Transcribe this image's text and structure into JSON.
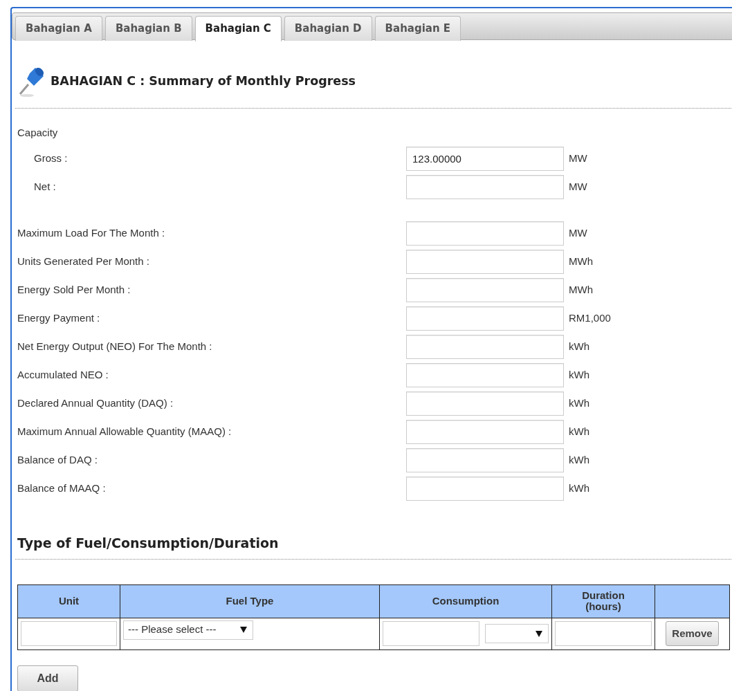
{
  "tabs": [
    {
      "label": "Bahagian A",
      "selected": false
    },
    {
      "label": "Bahagian B",
      "selected": false
    },
    {
      "label": "Bahagian C",
      "selected": true
    },
    {
      "label": "Bahagian D",
      "selected": false
    },
    {
      "label": "Bahagian E",
      "selected": false
    }
  ],
  "heading": "BAHAGIAN C : Summary of Monthly Progress",
  "capacity": {
    "label": "Capacity",
    "fields": [
      {
        "label": "Gross :",
        "value": "123.00000",
        "unit": "MW"
      },
      {
        "label": "Net :",
        "unit": "MW"
      }
    ]
  },
  "fields": [
    {
      "label": "Maximum Load For The Month :",
      "unit": "MW"
    },
    {
      "label": "Units Generated Per Month :",
      "unit": "MWh"
    },
    {
      "label": "Energy Sold Per Month :",
      "unit": "MWh"
    },
    {
      "label": "Energy Payment :",
      "unit": "RM1,000"
    },
    {
      "label": "Net Energy Output (NEO) For The Month :",
      "unit": "kWh"
    },
    {
      "label": "Accumulated NEO :",
      "unit": "kWh"
    },
    {
      "label": "Declared Annual Quantity (DAQ) :",
      "unit": "kWh"
    },
    {
      "label": "Maximum Annual Allowable Quantity (MAAQ) :",
      "unit": "kWh"
    },
    {
      "label": "Balance of DAQ :",
      "unit": "kWh"
    },
    {
      "label": "Balance of MAAQ :",
      "unit": "kWh"
    }
  ],
  "fuel_section": {
    "title": "Type of Fuel/Consumption/Duration",
    "table": {
      "columns": [
        "Unit",
        "Fuel Type",
        "Consumption",
        "Duration (hours)"
      ],
      "rows": [
        {
          "fuel_type": "--- Please select ---",
          "remove_button": "Remove"
        }
      ]
    },
    "add_button": "Add"
  }
}
